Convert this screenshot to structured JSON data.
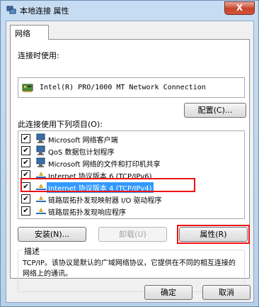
{
  "window": {
    "title": "本地连接 属性",
    "close_label": "X"
  },
  "tab": {
    "label": "网络"
  },
  "connect_using": {
    "label": "连接时使用:",
    "device": "Intel(R) PRO/1000 MT Network Connection",
    "configure_button": "配置(C)..."
  },
  "items_label": "此连接使用下列项目(O):",
  "items": [
    {
      "label": "Microsoft 网络客户端",
      "checked": true,
      "icon": "network-client-icon"
    },
    {
      "label": "QoS 数据包计划程序",
      "checked": true,
      "icon": "qos-scheduler-icon"
    },
    {
      "label": "Microsoft 网络的文件和打印机共享",
      "checked": true,
      "icon": "file-printer-sharing-icon"
    },
    {
      "label": "Internet 协议版本 6 (TCP/IPv6)",
      "checked": true,
      "icon": "protocol-icon"
    },
    {
      "label": "Internet 协议版本 4 (TCP/IPv4)",
      "checked": true,
      "icon": "protocol-icon",
      "selected": true
    },
    {
      "label": "链路层拓扑发现映射器 I/O 驱动程序",
      "checked": true,
      "icon": "protocol-icon"
    },
    {
      "label": "链路层拓扑发现响应程序",
      "checked": true,
      "icon": "protocol-icon"
    }
  ],
  "buttons": {
    "install": "安装(N)...",
    "uninstall": "卸载(U)",
    "properties": "属性(R)",
    "ok": "确定",
    "cancel": "取消"
  },
  "description": {
    "title": "描述",
    "text": "TCP/IP。该协议是默认的广域网络协议，它提供在不同的相互连接的网络上的通讯。"
  },
  "colors": {
    "selection": "#3399ff",
    "annotation_red": "#ee1111"
  }
}
